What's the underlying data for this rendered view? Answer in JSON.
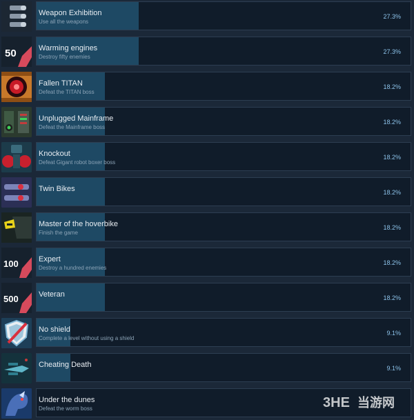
{
  "achievements": [
    {
      "title": "Weapon Exhibition",
      "description": "Use all the weapons",
      "percent_label": "27.3%",
      "percent": 27.3,
      "icon": "bullets-icon"
    },
    {
      "title": "Warming engines",
      "description": "Destroy fifty enemies",
      "percent_label": "27.3%",
      "percent": 27.3,
      "icon": "fifty-badge-icon",
      "icon_text": "50"
    },
    {
      "title": "Fallen TITAN",
      "description": "Defeat the TITAN boss",
      "percent_label": "18.2%",
      "percent": 18.2,
      "icon": "titan-eye-icon"
    },
    {
      "title": "Unplugged Mainframe",
      "description": "Defeat the Mainframe boss",
      "percent_label": "18.2%",
      "percent": 18.2,
      "icon": "mainframe-icon"
    },
    {
      "title": "Knockout",
      "description": "Defeat Gigant robot boxer boss",
      "percent_label": "18.2%",
      "percent": 18.2,
      "icon": "robot-boxer-icon"
    },
    {
      "title": "Twin Bikes",
      "description": "",
      "percent_label": "18.2%",
      "percent": 18.2,
      "icon": "twin-bikes-icon"
    },
    {
      "title": "Master of the hoverbike",
      "description": "Finish the game",
      "percent_label": "18.2%",
      "percent": 18.2,
      "icon": "hoverbike-icon"
    },
    {
      "title": "Expert",
      "description": "Destroy a hundred enemies",
      "percent_label": "18.2%",
      "percent": 18.2,
      "icon": "hundred-badge-icon",
      "icon_text": "100"
    },
    {
      "title": "Veteran",
      "description": "",
      "percent_label": "18.2%",
      "percent": 18.2,
      "icon": "five-hundred-badge-icon",
      "icon_text": "500"
    },
    {
      "title": "No shield",
      "description": "Complete a level without using a shield",
      "percent_label": "9.1%",
      "percent": 9.1,
      "icon": "shield-icon"
    },
    {
      "title": "Cheating Death",
      "description": "",
      "percent_label": "9.1%",
      "percent": 9.1,
      "icon": "ship-icon"
    },
    {
      "title": "Under the dunes",
      "description": "Defeat the worm boss",
      "percent_label": "",
      "percent": null,
      "icon": "worm-icon"
    }
  ],
  "watermark": {
    "brand": "3HE",
    "site": "当游网"
  },
  "colors": {
    "background": "#1b2838",
    "bar_fill": "#1e4964",
    "percent_text": "#8dc3ea"
  }
}
